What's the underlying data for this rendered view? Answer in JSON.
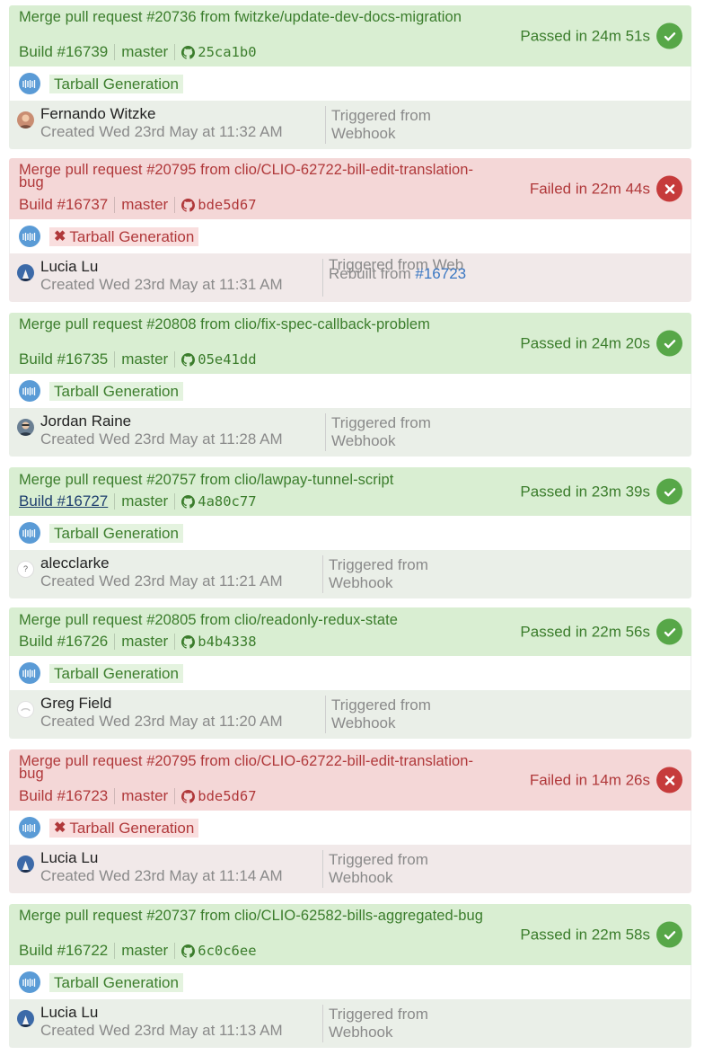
{
  "colors": {
    "passed": "#57a748",
    "failed": "#c63b3b",
    "link": "#3a77c2"
  },
  "builds": [
    {
      "state": "passed",
      "title": "Merge pull request #20736 from fwitzke/update-dev-docs-migration",
      "build": "Build #16739",
      "branch": "master",
      "commit": "25ca1b0",
      "status": "Passed in 24m 51s",
      "job": "Tarball Generation",
      "author": "Fernando Witzke",
      "created": "Created Wed 23rd May at 11:32 AM",
      "trigger_line1": "Triggered from",
      "trigger_line2": "Webhook",
      "avatar_icon": "photo-avatar-icon"
    },
    {
      "state": "failed",
      "title": "Merge pull request #20795 from clio/CLIO-62722-bill-edit-translation-bug",
      "build": "Build #16737",
      "branch": "master",
      "commit": "bde5d67",
      "status": "Failed in 22m 44s",
      "job": "Tarball Generation",
      "author": "Lucia Lu",
      "created": "Created Wed 23rd May at 11:31 AM",
      "trigger_line1": "Triggered from Web",
      "rebuilt_prefix": "Rebuilt from ",
      "rebuilt_link": "#16723",
      "avatar_icon": "photo-avatar-icon"
    },
    {
      "state": "passed",
      "title": "Merge pull request #20808 from clio/fix-spec-callback-problem",
      "build": "Build #16735",
      "branch": "master",
      "commit": "05e41dd",
      "status": "Passed in 24m 20s",
      "job": "Tarball Generation",
      "author": "Jordan Raine",
      "created": "Created Wed 23rd May at 11:28 AM",
      "trigger_line1": "Triggered from",
      "trigger_line2": "Webhook",
      "avatar_icon": "photo-avatar-icon"
    },
    {
      "state": "passed",
      "title": "Merge pull request #20757 from clio/lawpay-tunnel-script",
      "build": "Build #16727",
      "branch": "master",
      "commit": "4a80c77",
      "status": "Passed in 23m 39s",
      "job": "Tarball Generation",
      "author": "alecclarke",
      "created": "Created Wed 23rd May at 11:21 AM",
      "trigger_line1": "Triggered from",
      "trigger_line2": "Webhook",
      "avatar_icon": "unknown-avatar-icon"
    },
    {
      "state": "passed",
      "title": "Merge pull request #20805 from clio/readonly-redux-state",
      "build": "Build #16726",
      "branch": "master",
      "commit": "b4b4338",
      "status": "Passed in 22m 56s",
      "job": "Tarball Generation",
      "author": "Greg Field",
      "created": "Created Wed 23rd May at 11:20 AM",
      "trigger_line1": "Triggered from",
      "trigger_line2": "Webhook",
      "avatar_icon": "placeholder-avatar-icon"
    },
    {
      "state": "failed",
      "title": "Merge pull request #20795 from clio/CLIO-62722-bill-edit-translation-bug",
      "build": "Build #16723",
      "branch": "master",
      "commit": "bde5d67",
      "status": "Failed in 14m 26s",
      "job": "Tarball Generation",
      "author": "Lucia Lu",
      "created": "Created Wed 23rd May at 11:14 AM",
      "trigger_line1": "Triggered from",
      "trigger_line2": "Webhook",
      "avatar_icon": "photo-avatar-icon"
    },
    {
      "state": "passed",
      "title": "Merge pull request #20737 from clio/CLIO-62582-bills-aggregated-bug",
      "build": "Build #16722",
      "branch": "master",
      "commit": "6c0c6ee",
      "status": "Passed in 22m 58s",
      "job": "Tarball Generation",
      "author": "Lucia Lu",
      "created": "Created Wed 23rd May at 11:13 AM",
      "trigger_line1": "Triggered from",
      "trigger_line2": "Webhook",
      "avatar_icon": "photo-avatar-icon"
    }
  ]
}
